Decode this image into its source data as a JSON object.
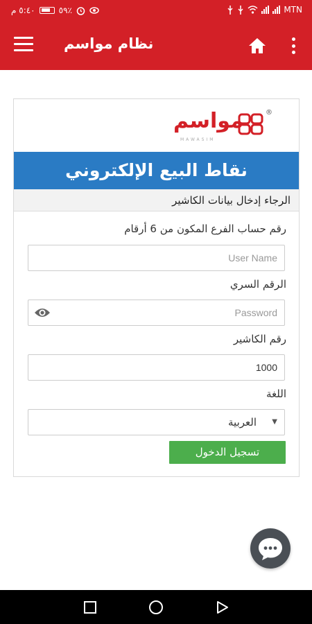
{
  "status_bar": {
    "time": "٥:٤٠ م",
    "battery_percent": "٥٩٪",
    "carrier": "MTN"
  },
  "app_bar": {
    "title": "نظام مواسم",
    "menu_icon": "hamburger-icon",
    "home_icon": "home-icon",
    "more_icon": "more-vertical-icon"
  },
  "logo": {
    "text": "مواسم",
    "subtext": "MAWASIM",
    "registered": "®"
  },
  "banner": {
    "title": "نقاط البيع الإلكتروني"
  },
  "form": {
    "instruction": "الرجاء إدخال بيانات الكاشير",
    "username_label": "رقم حساب الفرع المكون من 6 أرقام",
    "username_placeholder": "User Name",
    "username_value": "",
    "password_label": "الرقم السري",
    "password_placeholder": "Password",
    "password_value": "",
    "cashier_label": "رقم الكاشير",
    "cashier_value": "1000",
    "language_label": "اللغة",
    "language_selected": "العربية",
    "login_label": "تسجيل الدخول"
  },
  "colors": {
    "primary_red": "#d32027",
    "banner_blue": "#2a7bc4",
    "login_green": "#4cae4c",
    "chat_fab": "#4a4f55"
  }
}
